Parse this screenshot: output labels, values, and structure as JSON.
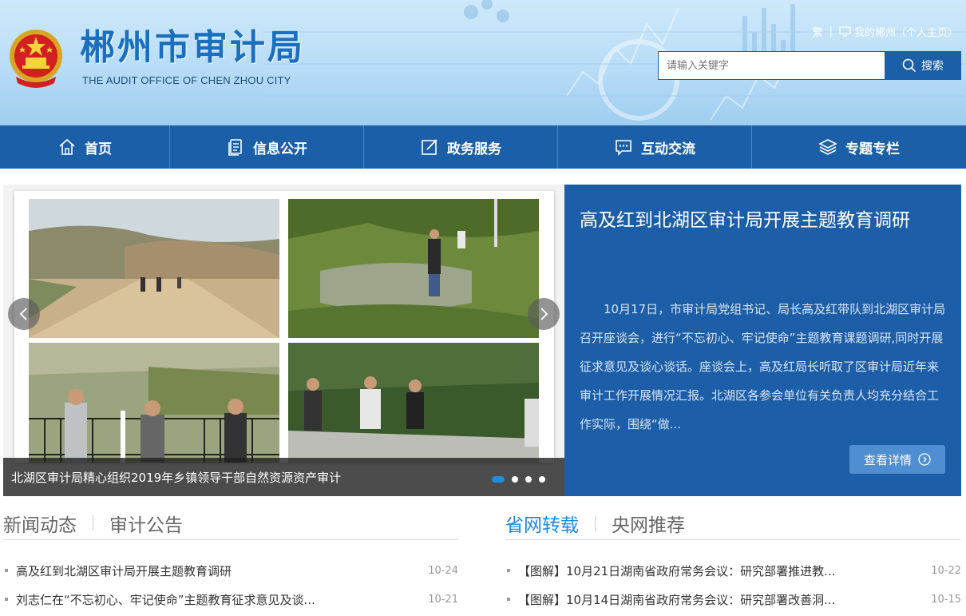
{
  "header": {
    "title": "郴州市审计局",
    "subtitle": "THE AUDIT OFFICE OF CHEN ZHOU CITY",
    "traditional_link": "繁",
    "my_chenzhou_link": "我的郴州（个人主页）",
    "search_placeholder": "请输入关键字",
    "search_button": "搜索"
  },
  "nav": [
    {
      "label": "首页",
      "icon": "home-icon"
    },
    {
      "label": "信息公开",
      "icon": "document-icon"
    },
    {
      "label": "政务服务",
      "icon": "edit-icon"
    },
    {
      "label": "互动交流",
      "icon": "chat-icon"
    },
    {
      "label": "专题专栏",
      "icon": "layers-icon"
    }
  ],
  "slider": {
    "caption": "北湖区审计局精心组织2019年乡镇领导干部自然资源资产审计",
    "dots": 4,
    "active_dot": 0
  },
  "feature": {
    "title": "高及红到北湖区审计局开展主题教育调研",
    "text": "10月17日，市审计局党组书记、局长高及红带队到北湖区审计局召开座谈会，进行“不忘初心、牢记使命”主题教育课题调研,同时开展征求意见及谈心谈话。座谈会上，高及红局长听取了区审计局近年来审计工作开展情况汇报。北湖区各参会单位有关负责人均充分结合工作实际，围绕“做...",
    "button": "查看详情"
  },
  "news_left": {
    "tabs": [
      "新闻动态",
      "审计公告"
    ],
    "active_tab": 0,
    "items": [
      {
        "title": "高及红到北湖区审计局开展主题教育调研",
        "date": "10-24"
      },
      {
        "title": "刘志仁在“不忘初心、牢记使命”主题教育征求意见及谈...",
        "date": "10-21"
      }
    ]
  },
  "news_right": {
    "tabs": [
      "省网转载",
      "央网推荐"
    ],
    "active_tab": 0,
    "items": [
      {
        "title": "【图解】10月21日湖南省政府常务会议：研究部署推进教...",
        "date": "10-22"
      },
      {
        "title": "【图解】10月14日湖南省政府常务会议：研究部署改善洞...",
        "date": "10-15"
      }
    ]
  },
  "colors": {
    "primary": "#1a5fa8",
    "feature_bg": "#1d5ea8",
    "accent": "#1a8ae0",
    "header_bg": "#b7dcf6"
  }
}
